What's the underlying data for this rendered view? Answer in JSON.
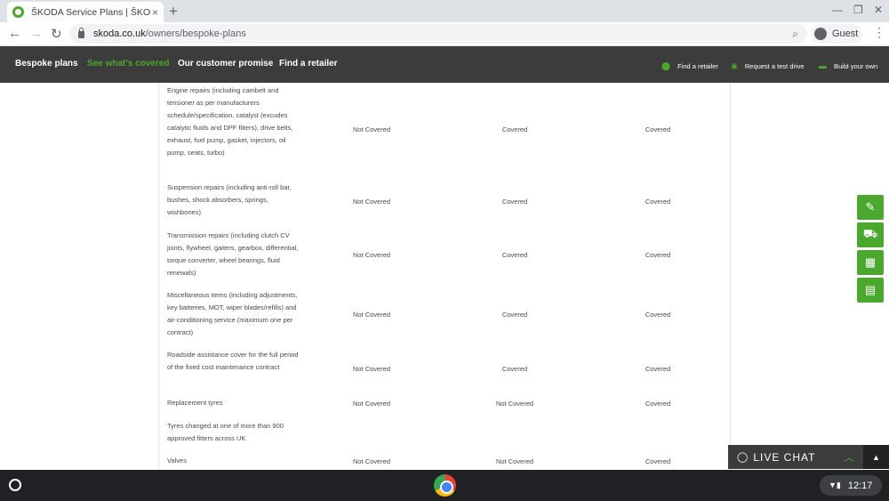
{
  "browser": {
    "tab_title": "ŠKODA Service Plans | ŠKODA UK",
    "tab_close": "×",
    "new_tab": "+",
    "url_domain": "skoda.co.uk",
    "url_path": "/owners/bespoke-plans",
    "profile_label": "Guest",
    "icons": [
      "back-icon",
      "forward-icon",
      "reload-icon",
      "lock-icon",
      "search-icon",
      "avatar-icon",
      "menu-icon"
    ]
  },
  "nav": {
    "links": [
      "Bespoke plans",
      "See what's covered",
      "Our customer promise",
      "Find a retailer"
    ],
    "right": [
      "Find a retailer",
      "Request a test drive",
      "Build your own"
    ],
    "accent": "#4ba82e",
    "background": "#3c3c3c"
  },
  "table": {
    "rows": [
      {
        "description": "Engine repairs (including cambelt and tensioner as per manufacturers schedule/specification, catalyst (excudes catalytic fluids and DPF filters), drive belts, exhaust, fuel pump, gasket, injectors, oil pump, seats, turbo)",
        "col1": "Not Covered",
        "col2": "Covered",
        "col3": "Covered"
      },
      {
        "description": "Suspension repairs (including anti-roll bar, bushes, shock absorbers, springs, wishbones)",
        "col1": "Not Covered",
        "col2": "Covered",
        "col3": "Covered"
      },
      {
        "description": "Transmission repairs (including clutch CV joints, flywheel, gaiters, gearbox, differential, torque converter, wheel bearings, fluid renewals)",
        "col1": "Not Covered",
        "col2": "Covered",
        "col3": "Covered"
      },
      {
        "description": "Miscellaneous items (including adjustments, key batteries, MOT, wiper blades/refills) and air-conditioning service (maximum one per contract)",
        "col1": "Not Covered",
        "col2": "Covered",
        "col3": "Covered"
      },
      {
        "description": "Roadside assistance cover for the full period of the fixed cost maintenance contract",
        "col1": "Not Covered",
        "col2": "Covered",
        "col3": "Covered"
      },
      {
        "description": "Replacement tyres",
        "col1": "Not Covered",
        "col2": "Not Covered",
        "col3": "Covered"
      },
      {
        "description": "Tyres changed at one of more than 900 approved fitters across UK",
        "col1": "",
        "col2": "",
        "col3": ""
      },
      {
        "description": "Valves",
        "col1": "Not Covered",
        "col2": "Not Covered",
        "col3": "Covered"
      }
    ]
  },
  "side_widgets": [
    "test-drive-icon",
    "cart-icon",
    "map-icon",
    "brochure-icon"
  ],
  "livechat": {
    "label": "LIVE CHAT"
  },
  "shelf": {
    "clock": "12:17"
  }
}
